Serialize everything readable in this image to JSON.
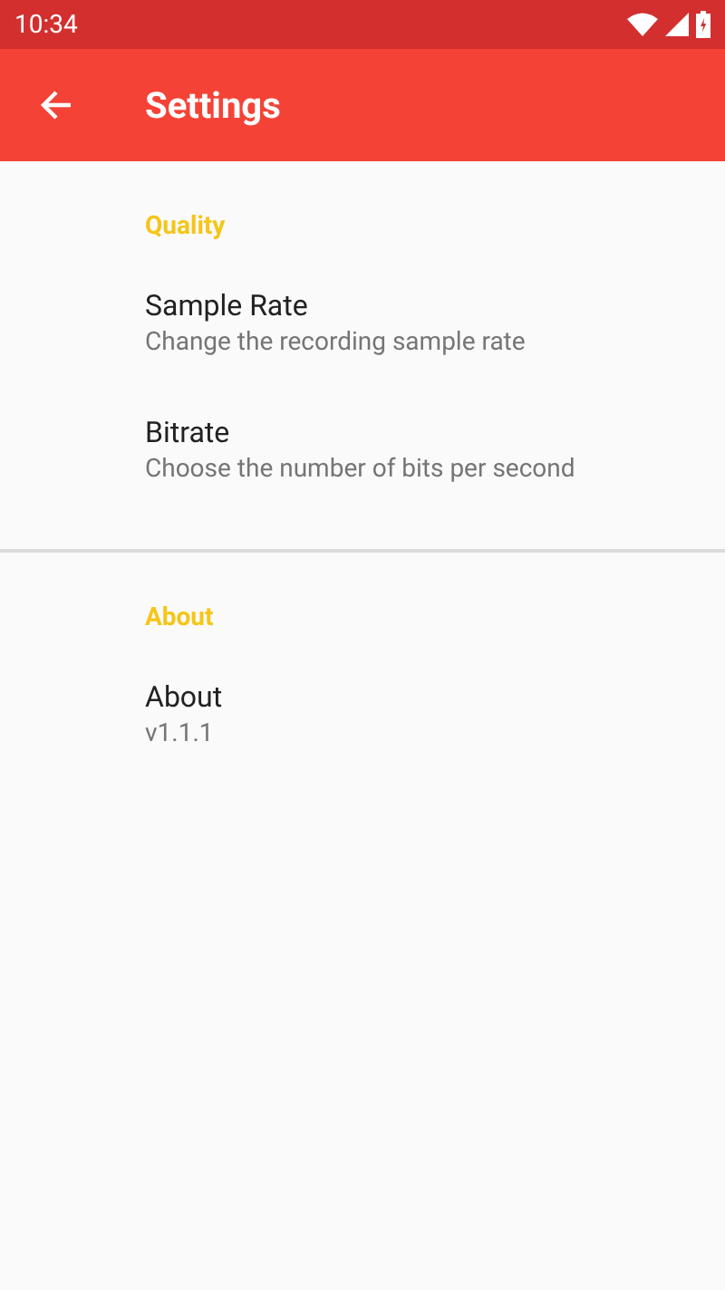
{
  "status_bar": {
    "time": "10:34"
  },
  "toolbar": {
    "title": "Settings"
  },
  "sections": [
    {
      "title": "Quality",
      "items": [
        {
          "title": "Sample Rate",
          "summary": "Change the recording sample rate"
        },
        {
          "title": "Bitrate",
          "summary": "Choose the number of bits per second"
        }
      ]
    },
    {
      "title": "About",
      "items": [
        {
          "title": "About",
          "summary": "v1.1.1"
        }
      ]
    }
  ]
}
